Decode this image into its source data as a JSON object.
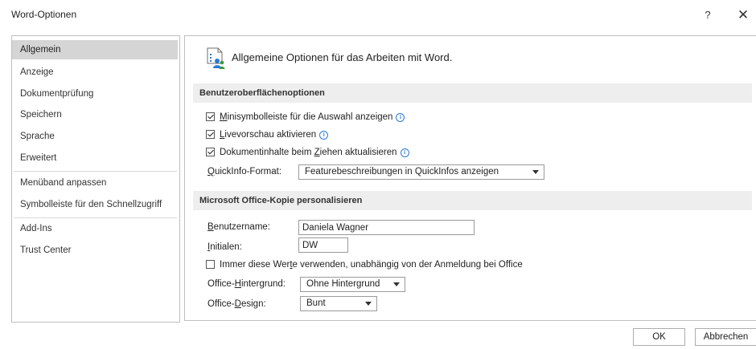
{
  "window": {
    "title": "Word-Optionen",
    "help_glyph": "?",
    "close_glyph": "✕"
  },
  "sidebar": {
    "items": [
      {
        "label": "Allgemein",
        "active": true
      },
      {
        "label": "Anzeige"
      },
      {
        "label": "Dokumentprüfung"
      },
      {
        "label": "Speichern"
      },
      {
        "label": "Sprache"
      },
      {
        "label": "Erweitert"
      },
      {
        "label": "Menüband anpassen"
      },
      {
        "label": "Symbolleiste für den Schnellzugriff"
      },
      {
        "label": "Add-Ins"
      },
      {
        "label": "Trust Center"
      }
    ]
  },
  "main": {
    "header": "Allgemeine Optionen für das Arbeiten mit Word.",
    "section1": {
      "title": "Benutzeroberflächenoptionen",
      "mini_pre": "",
      "mini_key": "M",
      "mini_post": "inisymbolleiste für die Auswahl anzeigen",
      "live_pre": "",
      "live_key": "L",
      "live_post": "ivevorschau aktivieren",
      "update_pre": "Dokumentinhalte beim ",
      "update_key": "Z",
      "update_post": "iehen aktualisieren",
      "quickinfo_key": "Q",
      "quickinfo_post": "uickInfo-Format:",
      "quickinfo_value": "Featurebeschreibungen in QuickInfos anzeigen",
      "checked": [
        true,
        true,
        true
      ]
    },
    "section2": {
      "title": "Microsoft Office-Kopie personalisieren",
      "username_key": "B",
      "username_post": "enutzername:",
      "username_value": "Daniela Wagner",
      "initials_key": "I",
      "initials_post": "nitialen:",
      "initials_value": "DW",
      "always_pre": "Immer diese Wer",
      "always_key": "t",
      "always_post": "e verwenden, unabhängig von der Anmeldung bei Office",
      "always_checked": false,
      "background_pre": "Office-",
      "background_key": "H",
      "background_post": "intergrund:",
      "background_value": "Ohne Hintergrund",
      "design_pre": "Office-",
      "design_key": "D",
      "design_post": "esign:",
      "design_value": "Bunt"
    }
  },
  "footer": {
    "ok_label": "OK",
    "cancel_label": "Abbrechen"
  },
  "colors": {
    "accent_info": "#2b79d8",
    "active_nav": "#d5d5d5",
    "section_bg": "#eeeeee"
  }
}
